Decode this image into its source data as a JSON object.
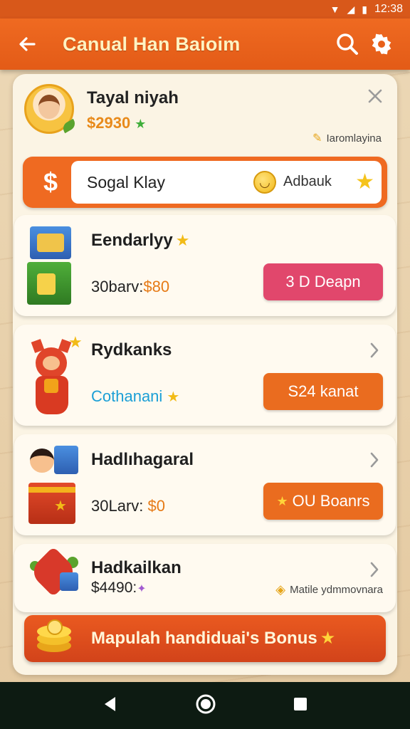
{
  "status_bar": {
    "time": "12:38"
  },
  "app_bar": {
    "title": "Canual Han Baioim"
  },
  "profile": {
    "name": "Tayal niyah",
    "balance": "$2930",
    "tag": "Iaromlayina"
  },
  "promo": {
    "symbol": "$",
    "field_text": "Sogal Klay",
    "right_text": "Adbauk"
  },
  "cards": [
    {
      "title": "Eendarlyy",
      "sub_prefix": "30barv:",
      "sub_value": "$80",
      "button": "3 D Deapn",
      "button_color": "#e1476c"
    },
    {
      "title": "Rydkanks",
      "sub": "Cothanani",
      "button": "S24 kanat",
      "button_color": "#ea6c1f"
    },
    {
      "title": "Hadlıhagaral",
      "sub_prefix": "30Larv: ",
      "sub_value": "$0",
      "button": "OU Boanrs",
      "button_color": "#ea6c1f"
    },
    {
      "title": "Hadkailkan",
      "sub": "$4490:",
      "note": "Matile ydmmovnara"
    }
  ],
  "bonus": {
    "label": "Mapulah handiduai's Bonus"
  },
  "colors": {
    "primary": "#ef6a21",
    "accent_pink": "#e1476c",
    "panel": "#fbf4e4"
  }
}
